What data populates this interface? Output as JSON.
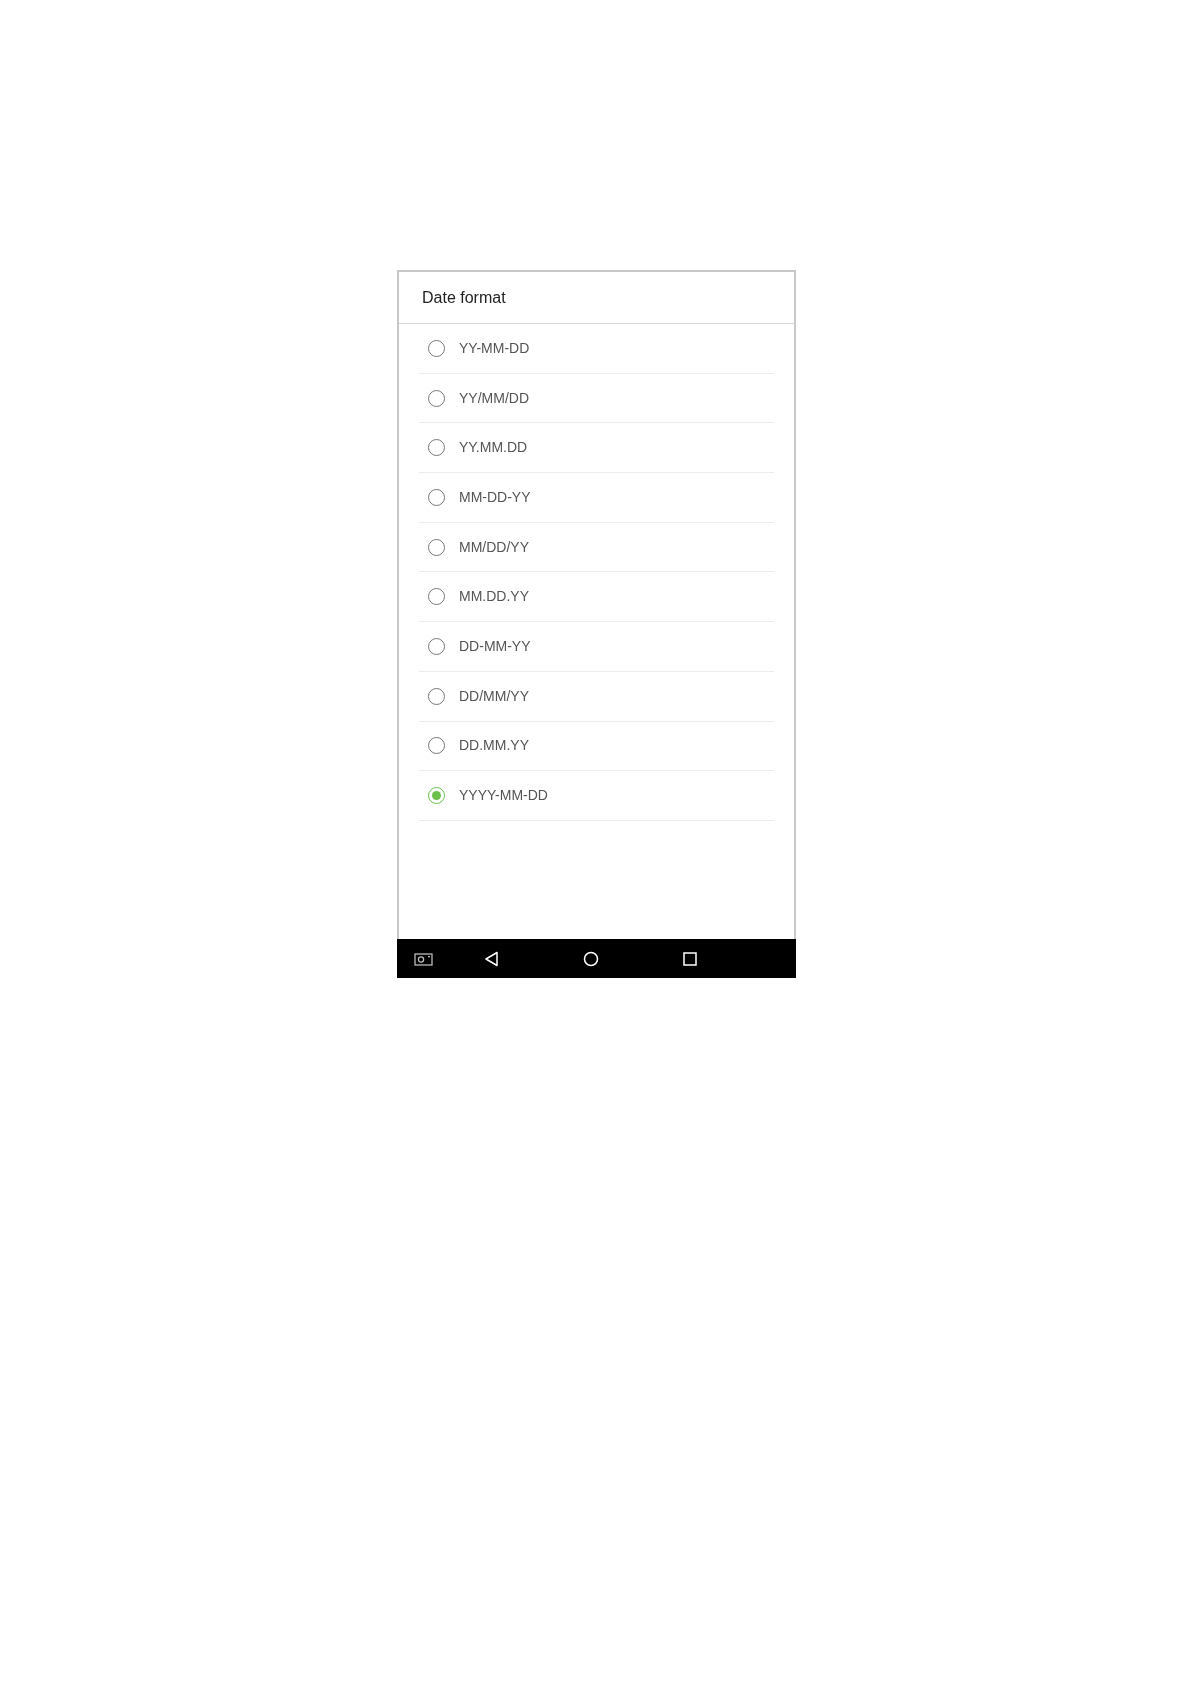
{
  "dialog": {
    "title": "Date format"
  },
  "options": [
    {
      "label": "YY-MM-DD",
      "selected": false
    },
    {
      "label": "YY/MM/DD",
      "selected": false
    },
    {
      "label": "YY.MM.DD",
      "selected": false
    },
    {
      "label": "MM-DD-YY",
      "selected": false
    },
    {
      "label": "MM/DD/YY",
      "selected": false
    },
    {
      "label": "MM.DD.YY",
      "selected": false
    },
    {
      "label": "DD-MM-YY",
      "selected": false
    },
    {
      "label": "DD/MM/YY",
      "selected": false
    },
    {
      "label": "DD.MM.YY",
      "selected": false
    },
    {
      "label": "YYYY-MM-DD",
      "selected": true
    }
  ]
}
